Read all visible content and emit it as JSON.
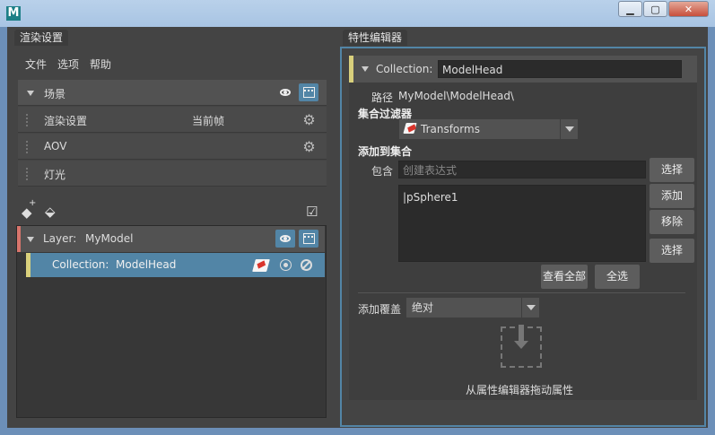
{
  "window": {
    "app_icon_glyph": "M",
    "minimize_glyph": "▁",
    "maximize_glyph": "▢",
    "close_glyph": "✕"
  },
  "left": {
    "tab_label": "渲染设置",
    "menu": [
      "文件",
      "选项",
      "帮助"
    ],
    "sections": {
      "scene_label": "场景",
      "render_settings_label": "渲染设置",
      "render_settings_value": "当前帧",
      "aov_label": "AOV",
      "lights_label": "灯光"
    },
    "tree": {
      "layer_prefix": "Layer:",
      "layer_name": "MyModel",
      "collection_prefix": "Collection:",
      "collection_name": "ModelHead"
    }
  },
  "right": {
    "tab_label": "特性编辑器",
    "collection_prefix": "Collection:",
    "collection_name": "ModelHead",
    "path_label": "路径",
    "path_value": "MyModel\\ModelHead\\",
    "filter_label": "集合过滤器",
    "filter_value": "Transforms",
    "add_to_collection_label": "添加到集合",
    "include_label": "包含",
    "include_placeholder": "创建表达式",
    "select_button": "选择",
    "add_button": "添加",
    "remove_button": "移除",
    "select_button_2": "选择",
    "members": [
      "|pSphere1"
    ],
    "view_all_button": "查看全部",
    "select_all_button": "全选",
    "add_override_label": "添加覆盖",
    "override_value": "绝对",
    "drag_hint": "从属性编辑器拖动属性"
  },
  "colors": {
    "accent_blue": "#5285a6",
    "layer_marker": "#d8756c",
    "collection_marker": "#d9d07c"
  }
}
